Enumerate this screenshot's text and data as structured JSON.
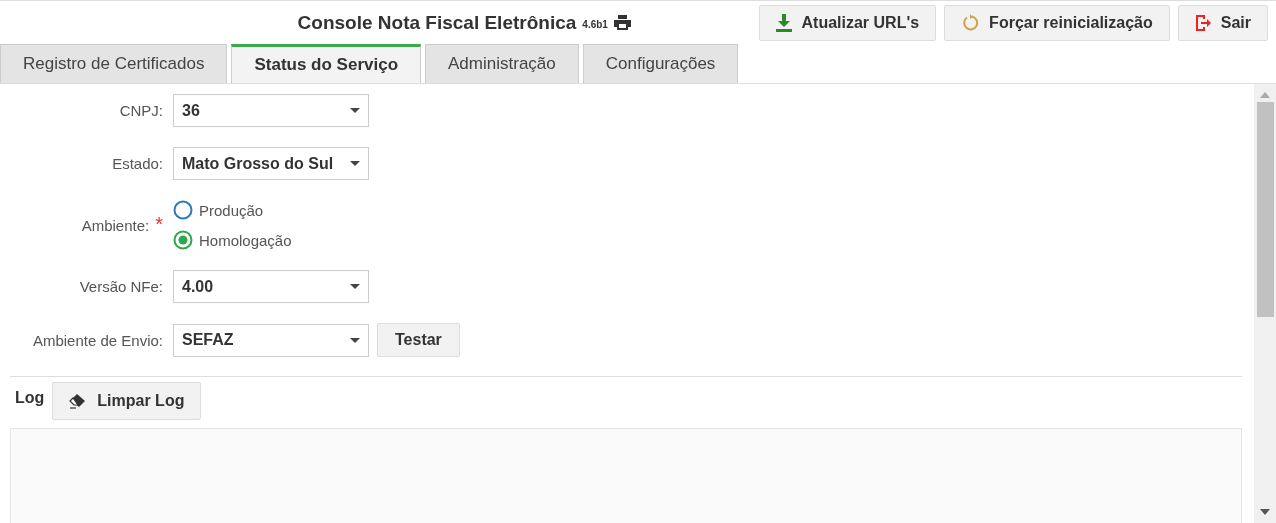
{
  "header": {
    "title": "Console Nota Fiscal Eletrônica",
    "version": "4.6b1"
  },
  "actions": [
    {
      "kind": "download",
      "label": "Atualizar URL's"
    },
    {
      "kind": "refresh",
      "label": "Forçar reinicialização"
    },
    {
      "kind": "exit",
      "label": "Sair"
    }
  ],
  "tabs": [
    {
      "label": "Registro de Certificados",
      "selected": false
    },
    {
      "label": "Status do Serviço",
      "selected": true
    },
    {
      "label": "Administração",
      "selected": false
    },
    {
      "label": "Configurações",
      "selected": false
    }
  ],
  "form": {
    "fields": [
      {
        "kind": "select",
        "label": "CNPJ:",
        "value": "36"
      },
      {
        "kind": "select",
        "label": "Estado:",
        "value": "Mato Grosso do Sul"
      },
      {
        "kind": "radio",
        "label": "Ambiente:",
        "required_mark": "*",
        "options": [
          {
            "label": "Produção",
            "selected": false
          },
          {
            "label": "Homologação",
            "selected": true
          }
        ]
      },
      {
        "kind": "select",
        "label": "Versão NFe:",
        "value": "4.00"
      },
      {
        "kind": "select",
        "label": "Ambiente de Envio:",
        "value": "SEFAZ",
        "button": "Testar"
      }
    ]
  },
  "log": {
    "title": "Log",
    "clear_button": "Limpar Log"
  }
}
